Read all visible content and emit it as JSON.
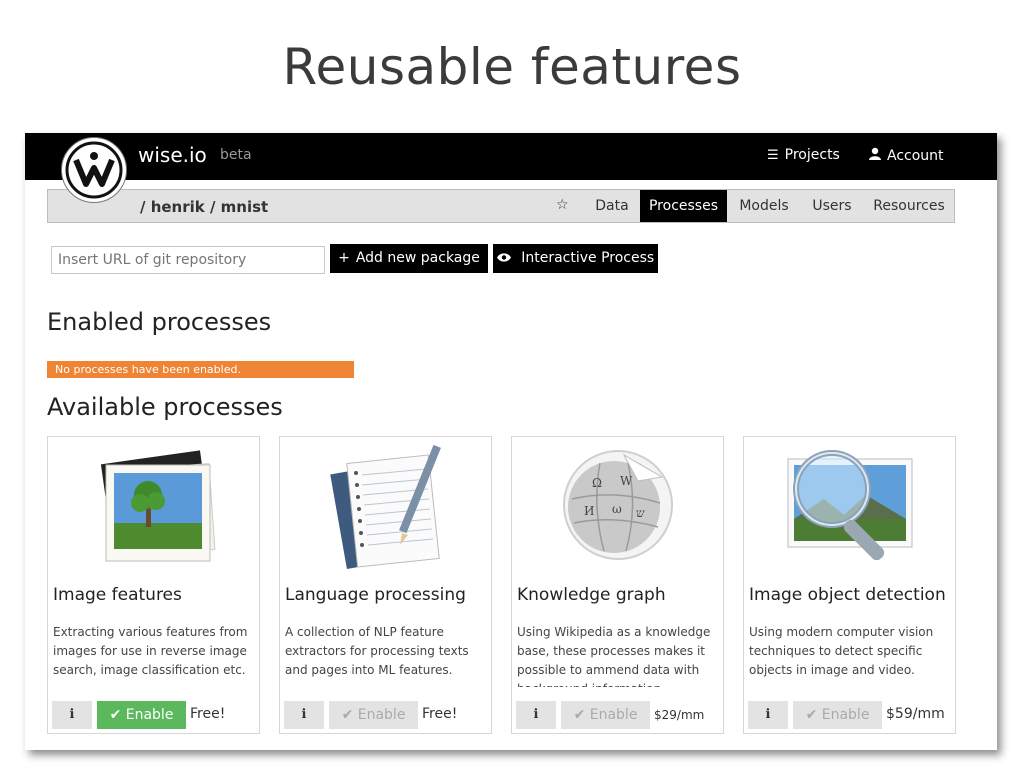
{
  "slide": {
    "title": "Reusable features"
  },
  "app": {
    "brand": "wise.io",
    "beta": "beta"
  },
  "topnav": [
    {
      "icon": "list-icon",
      "label": "Projects"
    },
    {
      "icon": "user-icon",
      "label": "Account"
    }
  ],
  "breadcrumb": "/ henrik / mnist",
  "tabs": [
    {
      "label": "Data",
      "active": false
    },
    {
      "label": "Processes",
      "active": true
    },
    {
      "label": "Models",
      "active": false
    },
    {
      "label": "Users",
      "active": false
    },
    {
      "label": "Resources",
      "active": false
    }
  ],
  "toolbar": {
    "git_placeholder": "Insert URL of git repository",
    "add_label": "Add new package",
    "interactive_label": "Interactive Process"
  },
  "enabled": {
    "heading": "Enabled processes",
    "alert": "No processes have been enabled."
  },
  "available": {
    "heading": "Available processes",
    "cards": [
      {
        "icon": "photo-icon",
        "title": "Image features",
        "desc": "Extracting various features from images for use in reverse image search, image classification etc.",
        "enable_label": "Enable",
        "enabled": true,
        "price": "Free!"
      },
      {
        "icon": "notepad-icon",
        "title": "Language processing",
        "desc": "A collection of NLP feature extractors for processing texts and pages into ML features.",
        "enable_label": "Enable",
        "enabled": false,
        "price": "Free!"
      },
      {
        "icon": "wikipedia-globe-icon",
        "title": "Knowledge graph",
        "desc": "Using Wikipedia as a knowledge base, these processes makes it possible to ammend data with background information",
        "enable_label": "Enable",
        "enabled": false,
        "price": "$29/mm"
      },
      {
        "icon": "magnifier-photo-icon",
        "title": "Image object detection",
        "desc": "Using modern computer vision techniques to detect specific objects in image and video.",
        "enable_label": "Enable",
        "enabled": false,
        "price": "$59/mm"
      }
    ]
  },
  "colors": {
    "topbar": "#000000",
    "alert": "#ee8434",
    "enable_active": "#5cb85c"
  }
}
